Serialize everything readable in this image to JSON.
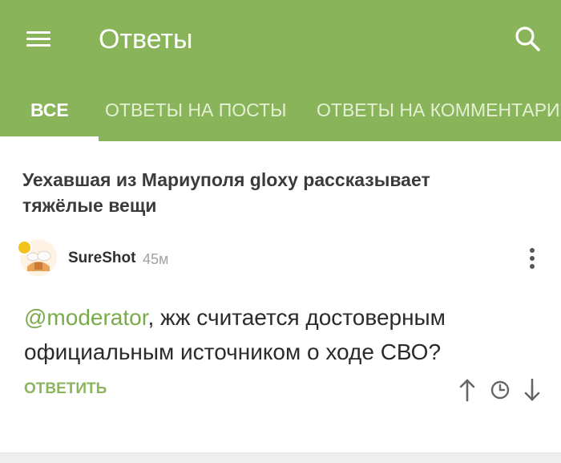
{
  "header": {
    "title": "Ответы",
    "menu_icon": "hamburger-menu-icon",
    "search_icon": "search-icon",
    "background": "#8ab45a"
  },
  "tabs": [
    {
      "label": "ВСЕ",
      "active": true
    },
    {
      "label": "ОТВЕТЫ НА ПОСТЫ",
      "active": false
    },
    {
      "label": "ОТВЕТЫ НА КОММЕНТАРИИ",
      "active": false
    }
  ],
  "post": {
    "title": "Уехавшая из Мариуполя gloxy рассказывает тяжёлые вещи"
  },
  "comment": {
    "author": "SureShot",
    "time_ago": "45м",
    "mention": "@moderator",
    "text": ",  жж считается достоверным официальным источником о ходе СВО?",
    "reply_label": "ОТВЕТИТЬ",
    "accent": "#8bb65c"
  }
}
